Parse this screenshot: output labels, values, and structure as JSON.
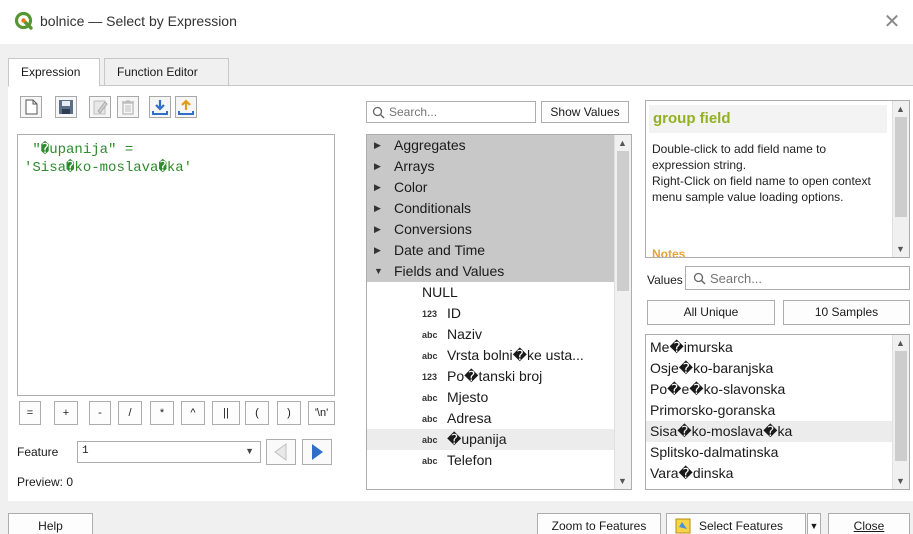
{
  "window": {
    "title": "bolnice — Select by Expression",
    "close_glyph": "✕"
  },
  "tabs": [
    {
      "label": "Expression"
    },
    {
      "label": "Function Editor"
    }
  ],
  "editor": {
    "text": " \"�upanija\" =\n'Sisa�ko-moslava�ka'"
  },
  "operators": [
    "=",
    "+",
    "-",
    "/",
    "*",
    "^",
    "||",
    "(",
    ")",
    "'\\n'"
  ],
  "feature": {
    "label": "Feature",
    "value": "1"
  },
  "preview": {
    "text": "Preview: 0"
  },
  "function_search": {
    "placeholder": "Search..."
  },
  "show_values_label": "Show Values",
  "function_tree": [
    {
      "label": "Aggregates",
      "kind": "group",
      "expanded": false
    },
    {
      "label": "Arrays",
      "kind": "group",
      "expanded": false
    },
    {
      "label": "Color",
      "kind": "group",
      "expanded": false
    },
    {
      "label": "Conditionals",
      "kind": "group",
      "expanded": false
    },
    {
      "label": "Conversions",
      "kind": "group",
      "expanded": false
    },
    {
      "label": "Date and Time",
      "kind": "group",
      "expanded": false
    },
    {
      "label": "Fields and Values",
      "kind": "group",
      "expanded": true
    },
    {
      "label": "NULL",
      "kind": "field",
      "type": ""
    },
    {
      "label": "ID",
      "kind": "field",
      "type": "123"
    },
    {
      "label": "Naziv",
      "kind": "field",
      "type": "abc"
    },
    {
      "label": "Vrsta bolni�ke usta...",
      "kind": "field",
      "type": "abc"
    },
    {
      "label": "Po�tanski broj",
      "kind": "field",
      "type": "123"
    },
    {
      "label": "Mjesto",
      "kind": "field",
      "type": "abc"
    },
    {
      "label": "Adresa",
      "kind": "field",
      "type": "abc"
    },
    {
      "label": "�upanija",
      "kind": "field",
      "type": "abc",
      "selected": true
    },
    {
      "label": "Telefon",
      "kind": "field",
      "type": "abc"
    }
  ],
  "help": {
    "title": "group field",
    "body": "Double-click to add field name to expression string.\nRight-Click on field name to open context menu sample value loading options.",
    "notes_heading": "Notes"
  },
  "values": {
    "label": "Values",
    "search_placeholder": "Search...",
    "all_unique_label": "All Unique",
    "samples_label": "10 Samples",
    "items": [
      {
        "text": "Me�imurska"
      },
      {
        "text": "Osje�ko-baranjska"
      },
      {
        "text": "Po�e�ko-slavonska"
      },
      {
        "text": "Primorsko-goranska"
      },
      {
        "text": "Sisa�ko-moslava�ka",
        "selected": true
      },
      {
        "text": "Splitsko-dalmatinska"
      },
      {
        "text": "Vara�dinska"
      }
    ]
  },
  "footer": {
    "help_label": "Help",
    "zoom_label": "Zoom to Features",
    "select_label": "Select Features",
    "close_label": "Close"
  },
  "colors": {
    "accent_green": "#93b023",
    "notes_orange": "#e6a33c",
    "expression_green": "#2e8b2e",
    "nav_blue": "#2f6fc8"
  }
}
